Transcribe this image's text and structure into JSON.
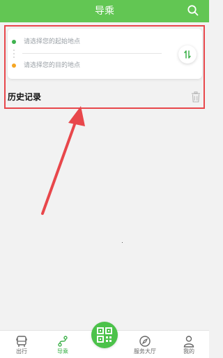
{
  "header": {
    "title": "导乘",
    "search_icon": "search-icon"
  },
  "route": {
    "origin_placeholder": "请选择您的起始地点",
    "destination_placeholder": "请选择您的目的地点",
    "origin_dot_color": "#3fb34f",
    "destination_dot_color": "#f5a623",
    "swap_icon": "swap-icon"
  },
  "history": {
    "title": "历史记录",
    "clear_icon": "trash-icon"
  },
  "tabs": [
    {
      "label": "出行",
      "icon": "bus-icon"
    },
    {
      "label": "导乘",
      "icon": "route-icon",
      "active": true
    },
    {
      "label": "",
      "icon": "qr-code-icon"
    },
    {
      "label": "服务大厅",
      "icon": "compass-icon"
    },
    {
      "label": "我的",
      "icon": "user-icon"
    }
  ],
  "colors": {
    "brand": "#62c653",
    "annotation": "#e8474b"
  }
}
